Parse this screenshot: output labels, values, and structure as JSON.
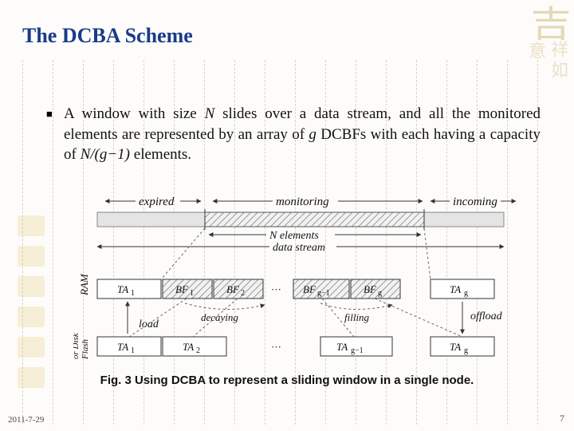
{
  "title": "The DCBA Scheme",
  "bullet_prefix": "A window with size ",
  "bullet_N": "N",
  "bullet_mid1": " slides over a data stream, and all the monitored elements are represented by an array of ",
  "bullet_g": "g",
  "bullet_mid2": " DCBFs with each having a capacity of ",
  "bullet_frac": "N/(g−1)",
  "bullet_tail": " elements.",
  "caption": "Fig. 3  Using DCBA to represent a sliding window in a single node.",
  "date": "2011-7-29",
  "page": "7",
  "fig": {
    "expired": "expired",
    "monitoring": "monitoring",
    "incoming": "incoming",
    "N_elements": "N elements",
    "data_stream": "data stream",
    "RAM": "RAM",
    "FlashOrDisk": "Flash or Disk",
    "load": "load",
    "offload": "offload",
    "decaying": "decaying",
    "filling": "filling",
    "TA1": "TA₁",
    "BF1": "BF₁",
    "BF2": "BF₂",
    "BFg1": "BFg−1",
    "BFg": "BFg",
    "TAg": "TAg",
    "TA2": "TA₂",
    "TAg1": "TAg−1",
    "dots": "···"
  },
  "decor": {
    "big": "吉",
    "col1": "祥如",
    "col2": "意"
  }
}
